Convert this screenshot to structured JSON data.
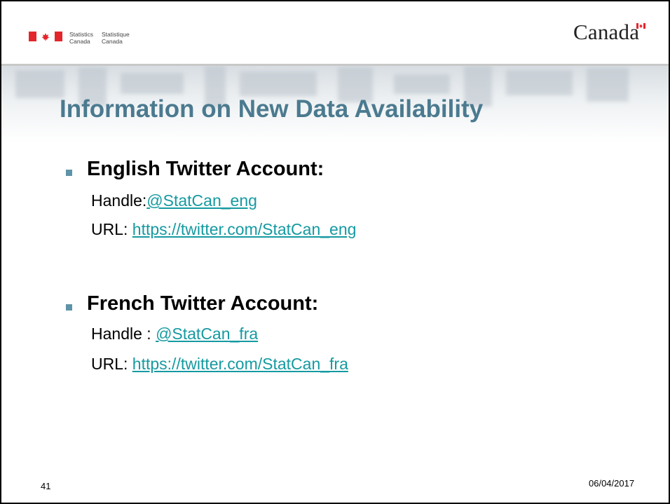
{
  "header": {
    "dept_en_line1": "Statistics",
    "dept_en_line2": "Canada",
    "dept_fr_line1": "Statistique",
    "dept_fr_line2": "Canada",
    "wordmark": "Canada",
    "flag_color": "#e3262b",
    "header_rule_color": "#c8c8c8"
  },
  "slide": {
    "title": "Information on New Data Availability",
    "title_color": "#4b7a8f",
    "bullet_color": "#5e93a8",
    "link_color": "#159aa1"
  },
  "sections": [
    {
      "heading": "English Twitter Account:",
      "handle_label": "Handle:",
      "handle_value": "@StatCan_eng",
      "url_label": "URL: ",
      "url_value": "https://twitter.com/StatCan_eng"
    },
    {
      "heading": "French Twitter Account:",
      "handle_label": "Handle : ",
      "handle_value": "@StatCan_fra",
      "url_label": "URL: ",
      "url_value": "https://twitter.com/StatCan_fra"
    }
  ],
  "footer": {
    "page_number": "41",
    "date": "06/04/2017"
  }
}
